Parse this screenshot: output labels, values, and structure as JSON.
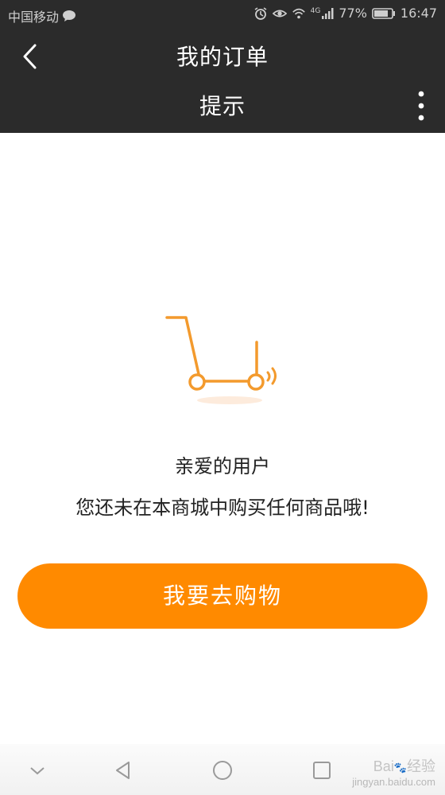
{
  "status": {
    "carrier": "中国移动",
    "network": "4G",
    "battery": "77%",
    "time": "16:47"
  },
  "header": {
    "title": "我的订单",
    "subtitle": "提示"
  },
  "empty_state": {
    "line1": "亲爱的用户",
    "line2": "您还未在本商城中购买任何商品哦!"
  },
  "actions": {
    "go_shopping": "我要去购物"
  },
  "watermark": {
    "text": "Bai",
    "sub": "经验",
    "site": "jingyan.baidu.com"
  },
  "colors": {
    "accent": "#ff8a00",
    "header_bg": "#2b2b2b"
  }
}
